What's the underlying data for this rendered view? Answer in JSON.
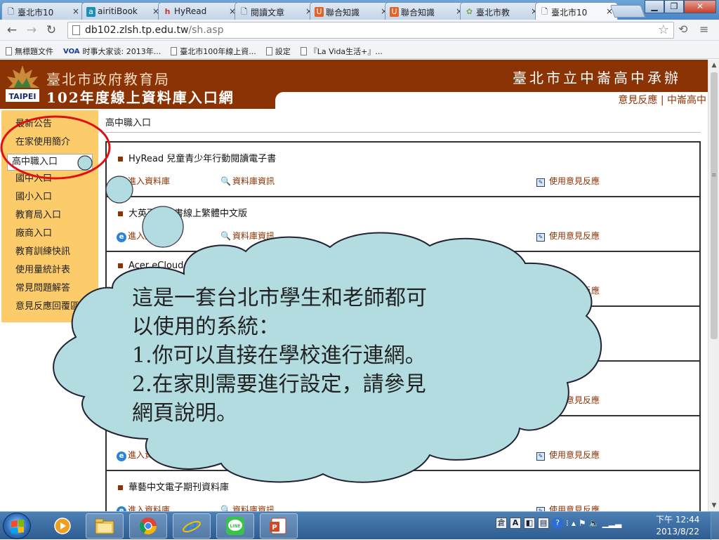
{
  "browser": {
    "tabs": [
      {
        "label": "臺北市10",
        "icon": "page-icon"
      },
      {
        "label": "airitiBook",
        "icon": "airiti-icon"
      },
      {
        "label": "HyRead",
        "icon": "hyread-icon"
      },
      {
        "label": "閱讀文章",
        "icon": "page-icon"
      },
      {
        "label": "聯合知識",
        "icon": "udn-icon"
      },
      {
        "label": "聯合知識",
        "icon": "udn-icon"
      },
      {
        "label": "臺北市教",
        "icon": "edu-icon"
      },
      {
        "label": "臺北市10",
        "icon": "page-icon",
        "active": true
      }
    ],
    "url_host": "db102.zlsh.tp.edu.tw",
    "url_path": "/sh.asp",
    "bookmarks": [
      "無標題文件",
      "时事大家谈: 2013年...",
      "臺北市100年線上資...",
      "設定",
      "『La Vida生活+』..."
    ],
    "voa_badge": "VOA"
  },
  "header": {
    "org": "臺北市政府教育局",
    "portal": "102年度線上資料庫入口網",
    "host_school": "臺北市立中崙高中承辦",
    "feedback_link": "意見反應",
    "separator": "|",
    "school_link": "中崙高中",
    "logo_text": "TAIPEI"
  },
  "sidebar": {
    "items": [
      {
        "label": "最新公告"
      },
      {
        "label": "在家使用簡介"
      },
      {
        "label": "高中職入口",
        "selected": true
      },
      {
        "label": "國中入口"
      },
      {
        "label": "國小入口"
      },
      {
        "label": "教育局入口"
      },
      {
        "label": "廠商入口"
      },
      {
        "label": "教育訓練快訊"
      },
      {
        "label": "使用量統計表"
      },
      {
        "label": "常見問題解答"
      },
      {
        "label": "意見反應回覆區"
      }
    ]
  },
  "main": {
    "title": "高中職入口",
    "link_enter": "進入資料庫",
    "link_info": "資料庫資訊",
    "link_feedback": "使用意見反應",
    "databases": [
      {
        "name": "HyRead 兒童青少年行動閱讀電子書"
      },
      {
        "name": "大英百科全書線上繁體中文版"
      },
      {
        "name": "Acer eCloud Library"
      },
      {
        "name": ""
      },
      {
        "name": ""
      },
      {
        "name": ""
      },
      {
        "name": "華藝中文電子期刊資料庫"
      }
    ]
  },
  "annotation": {
    "callout_lines": [
      "這是一套台北市學生和老師都可",
      "以使用的系統：",
      "1.你可以直接在學校進行連網。",
      "2.在家則需要進行設定，請參見",
      "網頁說明。"
    ],
    "ellipse_color": "#e01010",
    "cloud_color": "#b3dce0"
  },
  "taskbar": {
    "apps": [
      "media-player-icon",
      "explorer-icon",
      "chrome-icon",
      "ie-icon",
      "line-icon",
      "powerpoint-icon"
    ],
    "ime_label": "A",
    "time": "下午 12:44",
    "date": "2013/8/22"
  }
}
